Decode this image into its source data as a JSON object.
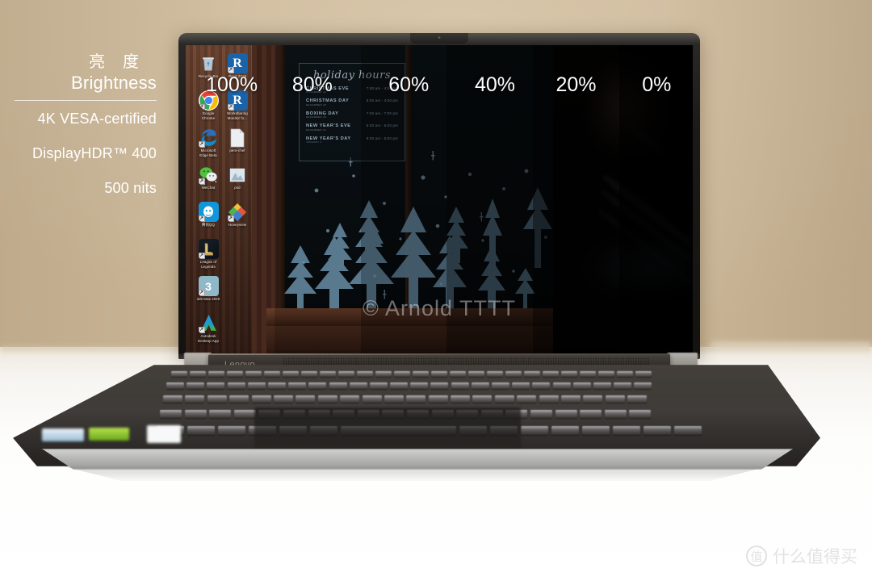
{
  "scene": {
    "type": "product-photo",
    "subject": "Lenovo laptop displaying brightness comparison test",
    "background_color": "#d2bfa2",
    "desk_color": "#ffffff"
  },
  "overlay": {
    "title_cn": "亮度",
    "title_en": "Brightness",
    "specs": [
      "4K VESA-certified",
      "DisplayHDR™ 400",
      "500 nits"
    ]
  },
  "brightness_steps": [
    {
      "label": "100%",
      "left_pct": 4,
      "dim": 0.0
    },
    {
      "label": "80%",
      "left_pct": 21,
      "dim": 0.18
    },
    {
      "label": "60%",
      "left_pct": 40,
      "dim": 0.4
    },
    {
      "label": "40%",
      "left_pct": 57,
      "dim": 0.6
    },
    {
      "label": "20%",
      "left_pct": 73,
      "dim": 0.76
    },
    {
      "label": "0%",
      "left_pct": 90,
      "dim": 0.9
    }
  ],
  "wallpaper": {
    "description": "Dark storefront window with light-blue painted pine trees and snowflakes, wooden sill",
    "tree_color": "#7ba7c4",
    "poster": {
      "title": "holiday hours",
      "rows": [
        {
          "event": "CHRISTMAS EVE",
          "date": "DECEMBER 24",
          "time": "7:00 am - 4:00 pm"
        },
        {
          "event": "CHRISTMAS DAY",
          "date": "DECEMBER 25",
          "time": "8:00 am - 4:00 pm"
        },
        {
          "event": "BOXING DAY",
          "date": "DECEMBER 26",
          "time": "7:00 am - 7:00 pm"
        },
        {
          "event": "NEW YEAR'S EVE",
          "date": "DECEMBER 31",
          "time": "6:00 am - 6:00 pm"
        },
        {
          "event": "NEW YEAR'S DAY",
          "date": "JANUARY 1",
          "time": "8:00 am - 6:00 pm"
        }
      ]
    }
  },
  "desktop_icons": [
    {
      "label": "Recycle Bin",
      "icon": "recycle-bin-icon",
      "col": 0,
      "row": 0,
      "bg": "#8a9aa6",
      "glyph": "♻",
      "shortcut": false
    },
    {
      "label": "Google\nChrome",
      "icon": "google-chrome-icon",
      "col": 0,
      "row": 1,
      "bg": "#ffffff",
      "glyph": "",
      "shortcut": true
    },
    {
      "label": "Microsoft\nEdge Beta",
      "icon": "microsoft-edge-beta-icon",
      "col": 0,
      "row": 2,
      "bg": "#0f3d63",
      "glyph": "",
      "shortcut": true
    },
    {
      "label": "WeChat",
      "icon": "wechat-icon",
      "col": 0,
      "row": 3,
      "bg": "transparent",
      "glyph": "",
      "shortcut": true
    },
    {
      "label": "腾讯QQ",
      "icon": "qq-icon",
      "col": 0,
      "row": 4,
      "bg": "#1296db",
      "glyph": "",
      "shortcut": true
    },
    {
      "label": "League of\nLegends",
      "icon": "league-of-legends-icon",
      "col": 0,
      "row": 5,
      "bg": "#0d1a22",
      "glyph": "",
      "shortcut": true
    },
    {
      "label": "3ds Max 2020",
      "icon": "3ds-max-2020-icon",
      "col": 0,
      "row": 6,
      "bg": "#8fb9c9",
      "glyph": "3",
      "shortcut": true
    },
    {
      "label": "Autodesk\nDesktop App",
      "icon": "autodesk-desktop-app-icon",
      "col": 0,
      "row": 7,
      "bg": "transparent",
      "glyph": "",
      "shortcut": true
    },
    {
      "label": "Revit 2018",
      "icon": "revit-2018-icon",
      "col": 1,
      "row": 0,
      "bg": "#1b63a8",
      "glyph": "R",
      "shortcut": true
    },
    {
      "label": "Worksharing\nMonitor fo...",
      "icon": "worksharing-monitor-icon",
      "col": 1,
      "row": 1,
      "bg": "#1b63a8",
      "glyph": "R",
      "shortcut": true
    },
    {
      "label": "pers-chef",
      "icon": "document-file-icon",
      "col": 1,
      "row": 2,
      "bg": "#e8e8e8",
      "glyph": "",
      "shortcut": false
    },
    {
      "label": "psd",
      "icon": "image-file-icon",
      "col": 1,
      "row": 3,
      "bg": "#c9d6de",
      "glyph": "",
      "shortcut": false
    },
    {
      "label": "Honeyview",
      "icon": "honeyview-icon",
      "col": 1,
      "row": 4,
      "bg": "transparent",
      "glyph": "",
      "shortcut": true
    }
  ],
  "laptop": {
    "brand": "Lenovo",
    "body_color": "#8e8a84",
    "hinge_color": "#39342f"
  },
  "watermarks": {
    "screen": "© Arnold TTTT",
    "corner_badge": "值",
    "corner_text": "什么值得买"
  }
}
